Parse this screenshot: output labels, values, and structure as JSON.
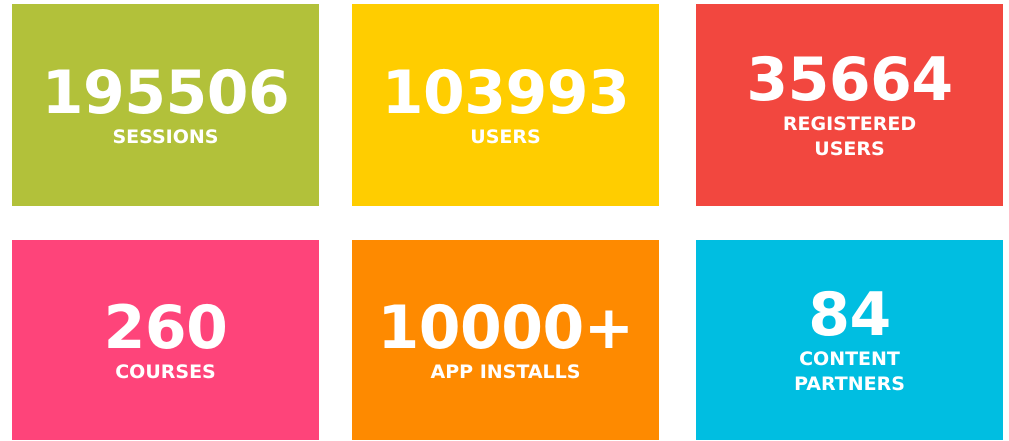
{
  "tiles": [
    {
      "value": "195506",
      "label": "SESSIONS",
      "color": "#b2c13a"
    },
    {
      "value": "103993",
      "label": "USERS",
      "color": "#ffcd00"
    },
    {
      "value": "35664",
      "label": "REGISTERED USERS",
      "color": "#f2473f"
    },
    {
      "value": "260",
      "label": "COURSES",
      "color": "#fe447a"
    },
    {
      "value": "10000+",
      "label": "APP INSTALLS",
      "color": "#fe8a00"
    },
    {
      "value": "84",
      "label": "CONTENT PARTNERS",
      "color": "#00bee1"
    }
  ]
}
